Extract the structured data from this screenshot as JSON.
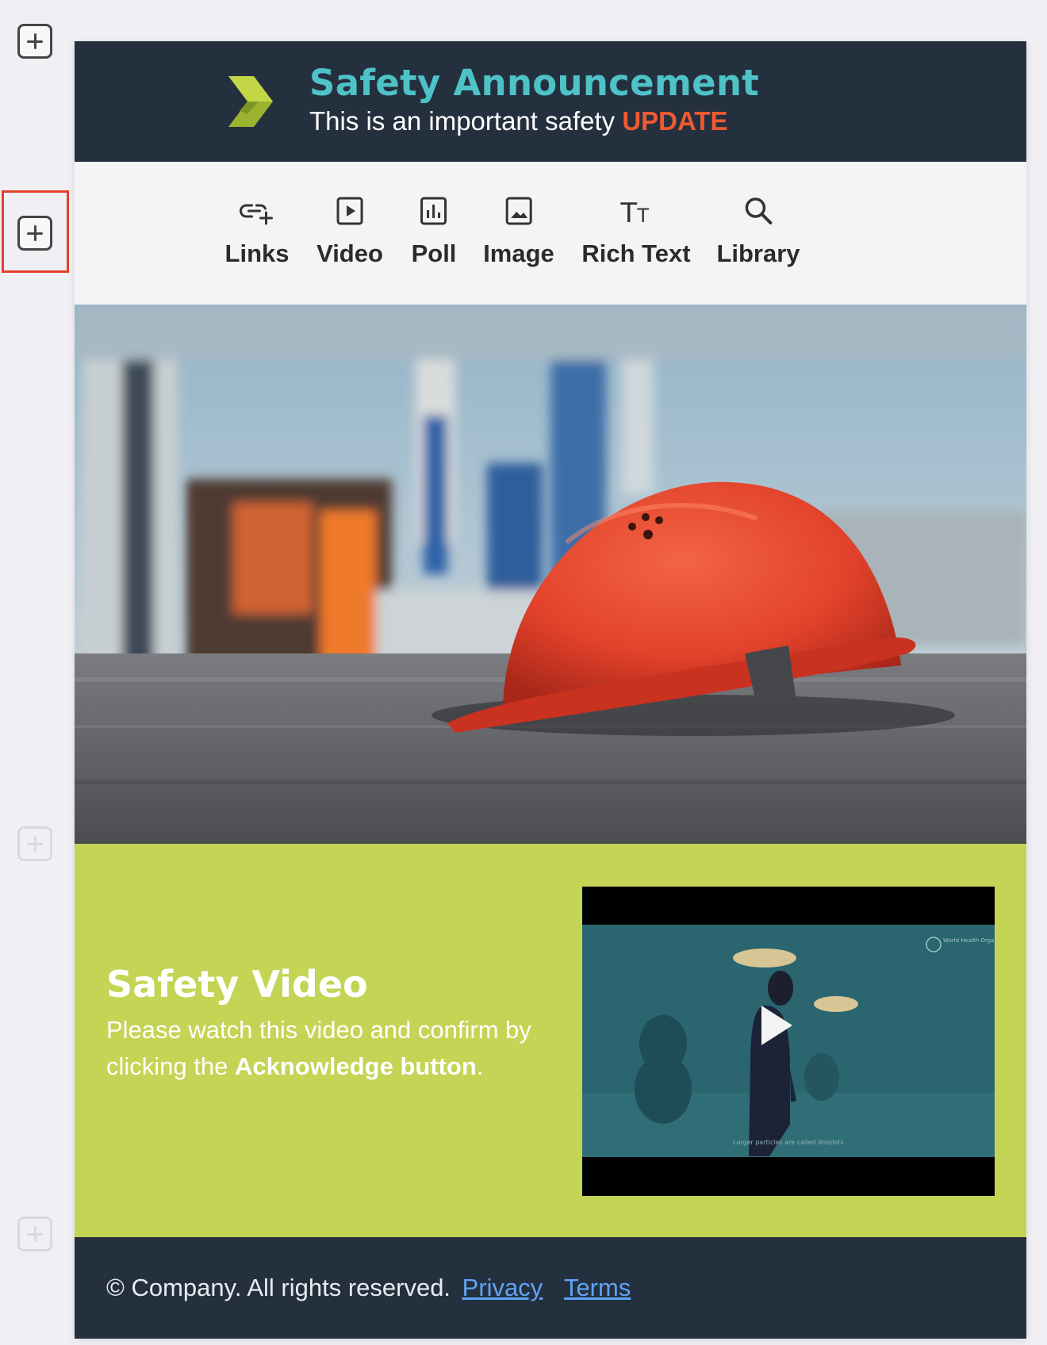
{
  "sidebar": {
    "add_block_label": "Add block"
  },
  "header": {
    "title": "Safety Announcement",
    "subtitle_prefix": "This is an important safety",
    "subtitle_highlight": "UPDATE",
    "colors": {
      "background": "#25303f",
      "title": "#4ec3c7",
      "highlight": "#ee5a2f"
    }
  },
  "toolbar": {
    "items": [
      {
        "label": "Links",
        "icon": "link-add-icon"
      },
      {
        "label": "Video",
        "icon": "video-play-icon"
      },
      {
        "label": "Poll",
        "icon": "poll-chart-icon"
      },
      {
        "label": "Image",
        "icon": "image-icon"
      },
      {
        "label": "Rich Text",
        "icon": "text-size-icon"
      },
      {
        "label": "Library",
        "icon": "search-icon"
      }
    ]
  },
  "hero": {
    "image_subject": "red hard hat on asphalt"
  },
  "video_section": {
    "title": "Safety Video",
    "desc_part1": "Please watch this video and confirm by clicking the",
    "desc_bold1": "Acknowledge",
    "desc_bold2": "button",
    "desc_end": ".",
    "video": {
      "watermark": "World Health Organization",
      "caption": "Larger particles are called droplets"
    },
    "colors": {
      "background": "#c4d455"
    }
  },
  "footer": {
    "copyright": "© Company. All rights reserved.",
    "privacy_label": "Privacy",
    "terms_label": "Terms",
    "link_color": "#5fa3f5"
  }
}
